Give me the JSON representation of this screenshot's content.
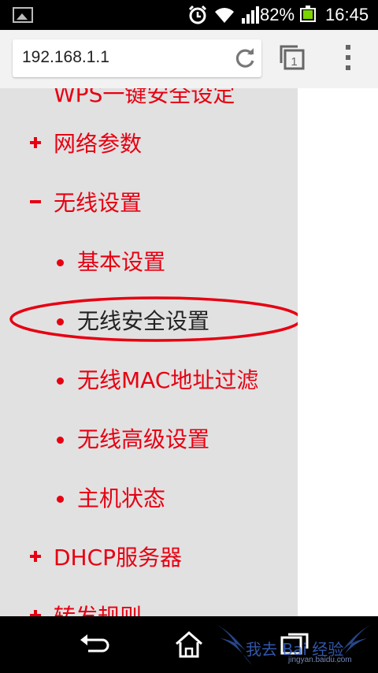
{
  "status": {
    "battery_percent": "82%",
    "time": "16:45",
    "battery_fill_fraction": 0.82
  },
  "browser": {
    "url": "192.168.1.1",
    "tab_count": "1"
  },
  "sidebar": {
    "cut_top_label": "WPS一键安全设定",
    "items": [
      {
        "label": "网络参数",
        "marker": "plus"
      },
      {
        "label": "无线设置",
        "marker": "minus"
      },
      {
        "label": "基本设置",
        "marker": "dot"
      },
      {
        "label": "无线安全设置",
        "marker": "dot",
        "highlighted": true
      },
      {
        "label": "无线MAC地址过滤",
        "marker": "dot"
      },
      {
        "label": "无线高级设置",
        "marker": "dot"
      },
      {
        "label": "主机状态",
        "marker": "dot"
      },
      {
        "label": "DHCP服务器",
        "marker": "plus"
      },
      {
        "label": "转发规则",
        "marker": "plus"
      }
    ]
  },
  "watermark": {
    "text": "我去 Bai 经验",
    "sub": "jingyan.baidu.com"
  },
  "colors": {
    "accent": "#e60012",
    "sidebar_bg": "#e1e1e1"
  }
}
